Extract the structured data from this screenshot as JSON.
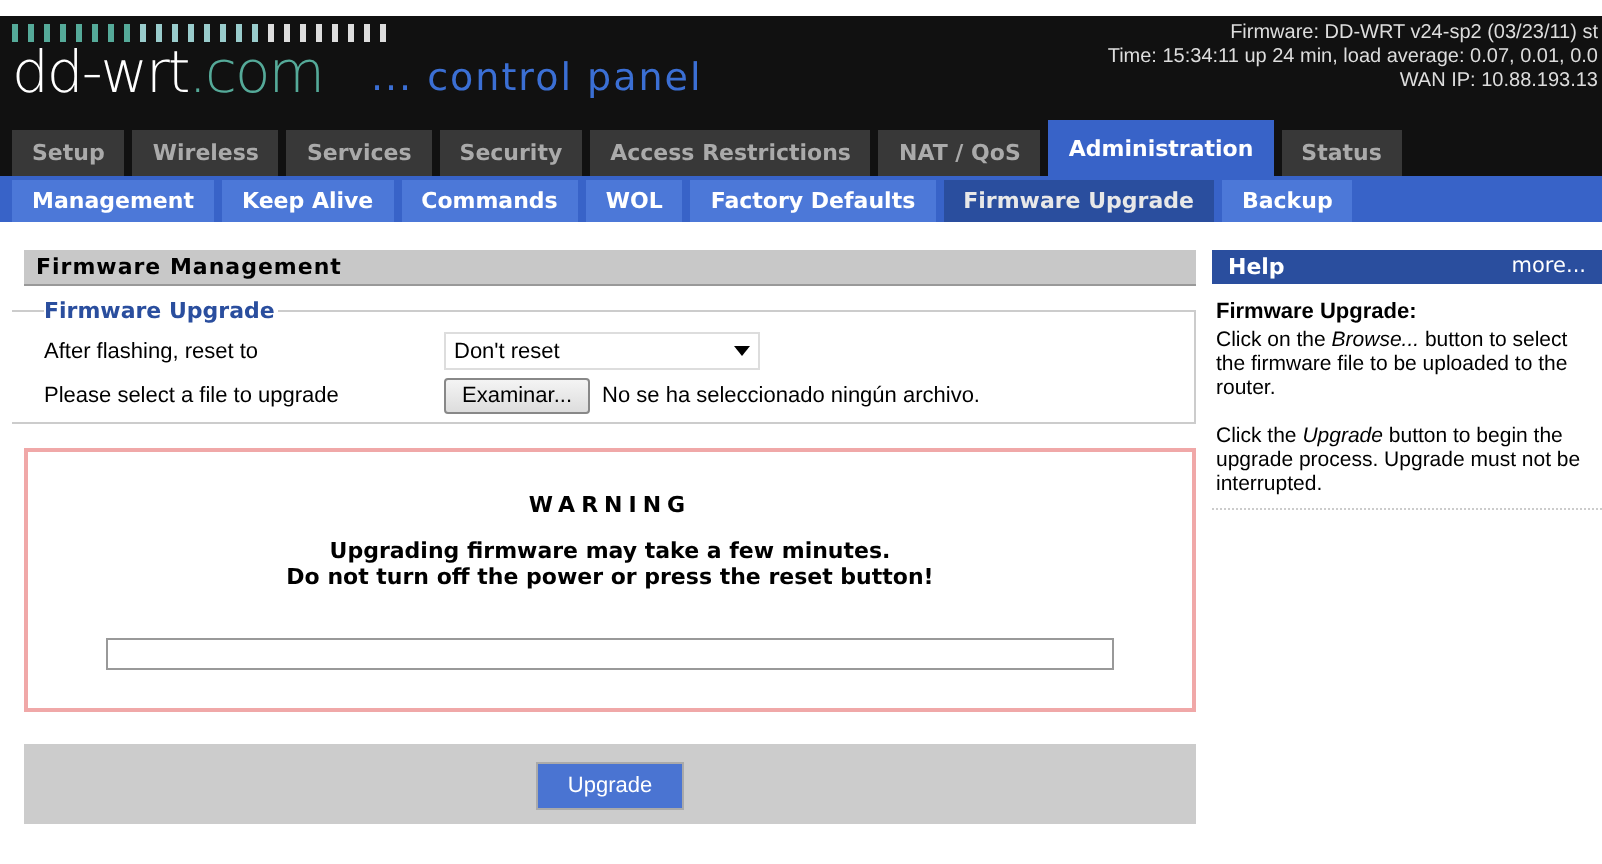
{
  "header": {
    "logo_main": "dd-wrt",
    "logo_suffix": ".com",
    "tagline": "... control panel",
    "info": [
      "Firmware: DD-WRT v24-sp2 (03/23/11) st",
      "Time: 15:34:11 up 24 min, load average: 0.07, 0.01, 0.0",
      "WAN IP: 10.88.193.13"
    ]
  },
  "tabs": [
    {
      "label": "Setup",
      "selected": false
    },
    {
      "label": "Wireless",
      "selected": false
    },
    {
      "label": "Services",
      "selected": false
    },
    {
      "label": "Security",
      "selected": false
    },
    {
      "label": "Access Restrictions",
      "selected": false
    },
    {
      "label": "NAT / QoS",
      "selected": false
    },
    {
      "label": "Administration",
      "selected": true
    },
    {
      "label": "Status",
      "selected": false
    }
  ],
  "subtabs": [
    {
      "label": "Management",
      "selected": false
    },
    {
      "label": "Keep Alive",
      "selected": false
    },
    {
      "label": "Commands",
      "selected": false
    },
    {
      "label": "WOL",
      "selected": false
    },
    {
      "label": "Factory Defaults",
      "selected": false
    },
    {
      "label": "Firmware Upgrade",
      "selected": true
    },
    {
      "label": "Backup",
      "selected": false
    }
  ],
  "section_title": "Firmware Management",
  "fieldset": {
    "legend": "Firmware Upgrade",
    "reset_label": "After flashing, reset to",
    "reset_value": "Don't reset",
    "file_label": "Please select a file to upgrade",
    "file_button": "Examinar...",
    "file_status": "No se ha seleccionado ningún archivo."
  },
  "warning": {
    "title": "WARNING",
    "lines": [
      "Upgrading firmware may take a few minutes.",
      "Do not turn off the power or press the reset button!"
    ],
    "progress": {
      "level": 0
    }
  },
  "upgrade_button": "Upgrade",
  "help": {
    "title": "Help",
    "more": "more...",
    "heading": "Firmware Upgrade:",
    "paragraphs": [
      "Click on the *Browse...* button to select the firmware file to be uploaded to the router.",
      "Click the *Upgrade* button to begin the upgrade process. Upgrade must not be interrupted."
    ]
  }
}
